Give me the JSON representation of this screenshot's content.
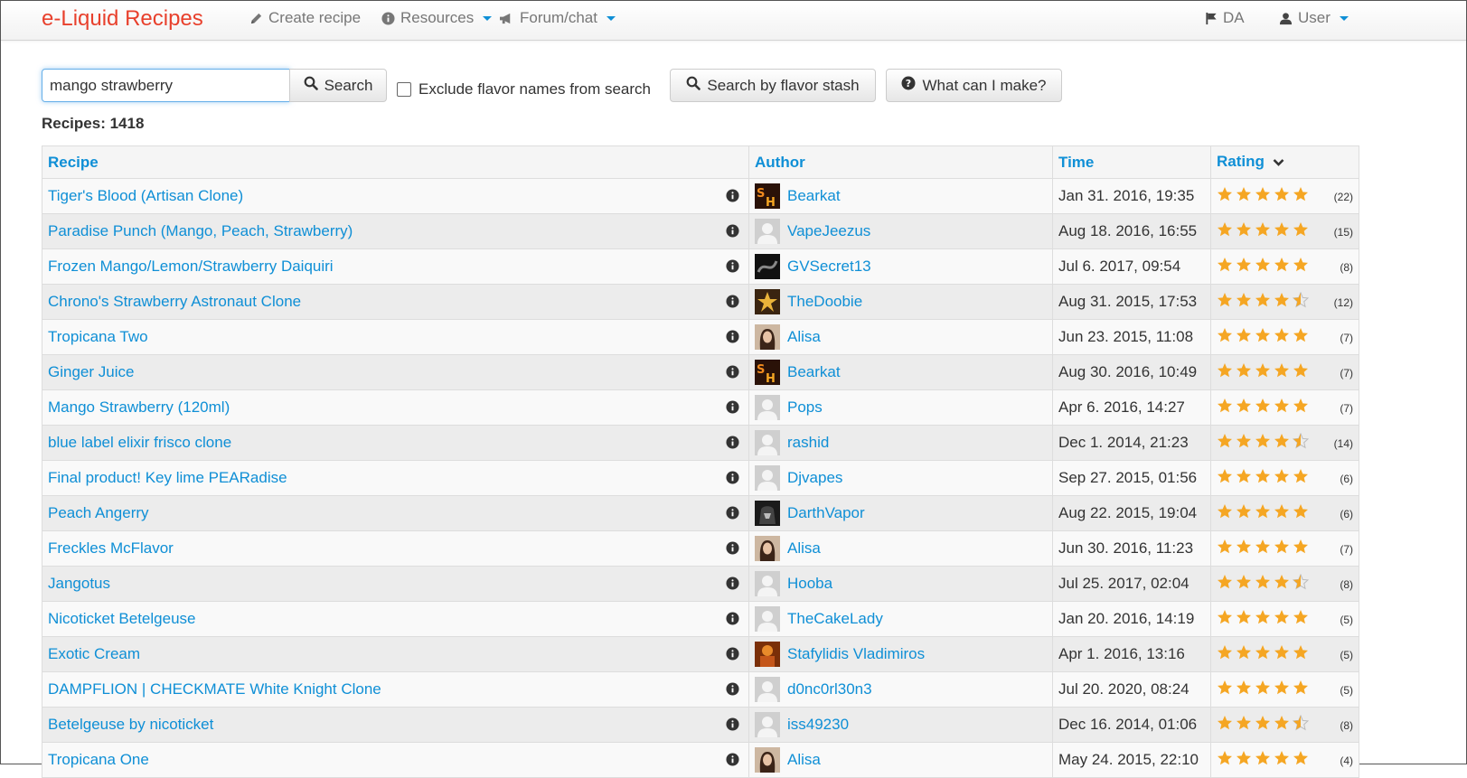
{
  "navbar": {
    "brand": "e-Liquid Recipes",
    "create_recipe": "Create recipe",
    "resources": "Resources",
    "forum_chat": "Forum/chat",
    "language": "DA",
    "user": "User"
  },
  "search": {
    "value": "mango strawberry",
    "search_label": "Search",
    "exclude_label": "Exclude flavor names from search",
    "stash_label": "Search by flavor stash",
    "make_label": "What can I make?"
  },
  "results": {
    "count_label": "Recipes: 1418"
  },
  "table": {
    "headers": {
      "recipe": "Recipe",
      "author": "Author",
      "time": "Time",
      "rating": "Rating"
    },
    "rows": [
      {
        "recipe": "Tiger's Blood (Artisan Clone)",
        "author": "Bearkat",
        "avatar": "sh",
        "time": "Jan 31. 2016, 19:35",
        "stars": 5,
        "count": "(22)"
      },
      {
        "recipe": "Paradise Punch (Mango, Peach, Strawberry)",
        "author": "VapeJeezus",
        "avatar": "default",
        "time": "Aug 18. 2016, 16:55",
        "stars": 5,
        "count": "(15)"
      },
      {
        "recipe": "Frozen Mango/Lemon/Strawberry Daiquiri",
        "author": "GVSecret13",
        "avatar": "dark",
        "time": "Jul 6. 2017, 09:54",
        "stars": 5,
        "count": "(8)"
      },
      {
        "recipe": "Chrono's Strawberry Astronaut Clone",
        "author": "TheDoobie",
        "avatar": "gold",
        "time": "Aug 31. 2015, 17:53",
        "stars": 4.5,
        "count": "(12)"
      },
      {
        "recipe": "Tropicana Two",
        "author": "Alisa",
        "avatar": "photo",
        "time": "Jun 23. 2015, 11:08",
        "stars": 5,
        "count": "(7)"
      },
      {
        "recipe": "Ginger Juice",
        "author": "Bearkat",
        "avatar": "sh",
        "time": "Aug 30. 2016, 10:49",
        "stars": 5,
        "count": "(7)"
      },
      {
        "recipe": "Mango Strawberry (120ml)",
        "author": "Pops",
        "avatar": "default",
        "time": "Apr 6. 2016, 14:27",
        "stars": 5,
        "count": "(7)"
      },
      {
        "recipe": "blue label elixir frisco clone",
        "author": "rashid",
        "avatar": "default",
        "time": "Dec 1. 2014, 21:23",
        "stars": 4.5,
        "count": "(14)"
      },
      {
        "recipe": "Final product! Key lime PEARadise",
        "author": "Djvapes",
        "avatar": "default",
        "time": "Sep 27. 2015, 01:56",
        "stars": 5,
        "count": "(6)"
      },
      {
        "recipe": "Peach Angerry",
        "author": "DarthVapor",
        "avatar": "vader",
        "time": "Aug 22. 2015, 19:04",
        "stars": 5,
        "count": "(6)"
      },
      {
        "recipe": "Freckles McFlavor",
        "author": "Alisa",
        "avatar": "photo",
        "time": "Jun 30. 2016, 11:23",
        "stars": 5,
        "count": "(7)"
      },
      {
        "recipe": "Jangotus",
        "author": "Hooba",
        "avatar": "default",
        "time": "Jul 25. 2017, 02:04",
        "stars": 4.5,
        "count": "(8)"
      },
      {
        "recipe": "Nicoticket Betelgeuse",
        "author": "TheCakeLady",
        "avatar": "default",
        "time": "Jan 20. 2016, 14:19",
        "stars": 5,
        "count": "(5)"
      },
      {
        "recipe": "Exotic Cream",
        "author": "Stafylidis Vladimiros",
        "avatar": "orange",
        "time": "Apr 1. 2016, 13:16",
        "stars": 5,
        "count": "(5)"
      },
      {
        "recipe": "DAMPFLION | CHECKMATE White Knight Clone",
        "author": "d0nc0rl30n3",
        "avatar": "default",
        "time": "Jul 20. 2020, 08:24",
        "stars": 5,
        "count": "(5)"
      },
      {
        "recipe": "Betelgeuse by nicoticket",
        "author": "iss49230",
        "avatar": "default",
        "time": "Dec 16. 2014, 01:06",
        "stars": 4.5,
        "count": "(8)"
      },
      {
        "recipe": "Tropicana One",
        "author": "Alisa",
        "avatar": "photo",
        "time": "May 24. 2015, 22:10",
        "stars": 5,
        "count": "(4)"
      }
    ]
  },
  "colors": {
    "brand": "#e8402c",
    "link": "#0f8fd6",
    "star": "#f5a623"
  },
  "icons": {
    "create": "pencil-icon",
    "resources": "info-circle-icon",
    "forum": "megaphone-icon",
    "language": "flag-icon",
    "user": "user-icon",
    "search": "search-icon",
    "what_can_i_make": "question-circle-icon",
    "recipe_info": "info-circle-icon",
    "sort": "chevron-down-icon"
  }
}
